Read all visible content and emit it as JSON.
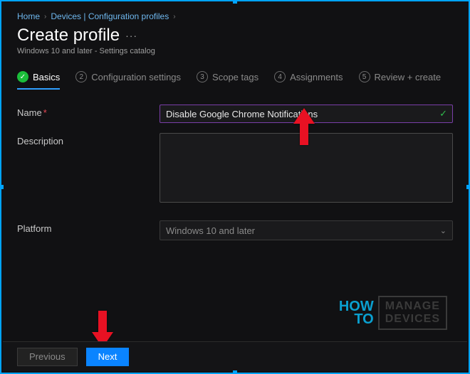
{
  "breadcrumb": {
    "home": "Home",
    "devices": "Devices | Configuration profiles"
  },
  "header": {
    "title": "Create profile",
    "subtitle": "Windows 10 and later - Settings catalog"
  },
  "tabs": {
    "basics": "Basics",
    "config": "Configuration settings",
    "scope": "Scope tags",
    "assign": "Assignments",
    "review": "Review + create"
  },
  "form": {
    "name_label": "Name",
    "name_value": "Disable Google Chrome Notifications",
    "desc_label": "Description",
    "desc_value": "",
    "platform_label": "Platform",
    "platform_value": "Windows 10 and later"
  },
  "footer": {
    "previous": "Previous",
    "next": "Next"
  },
  "watermark": {
    "how": "HOW",
    "to": "TO",
    "manage": "MANAGE",
    "devices": "DEVICES"
  }
}
